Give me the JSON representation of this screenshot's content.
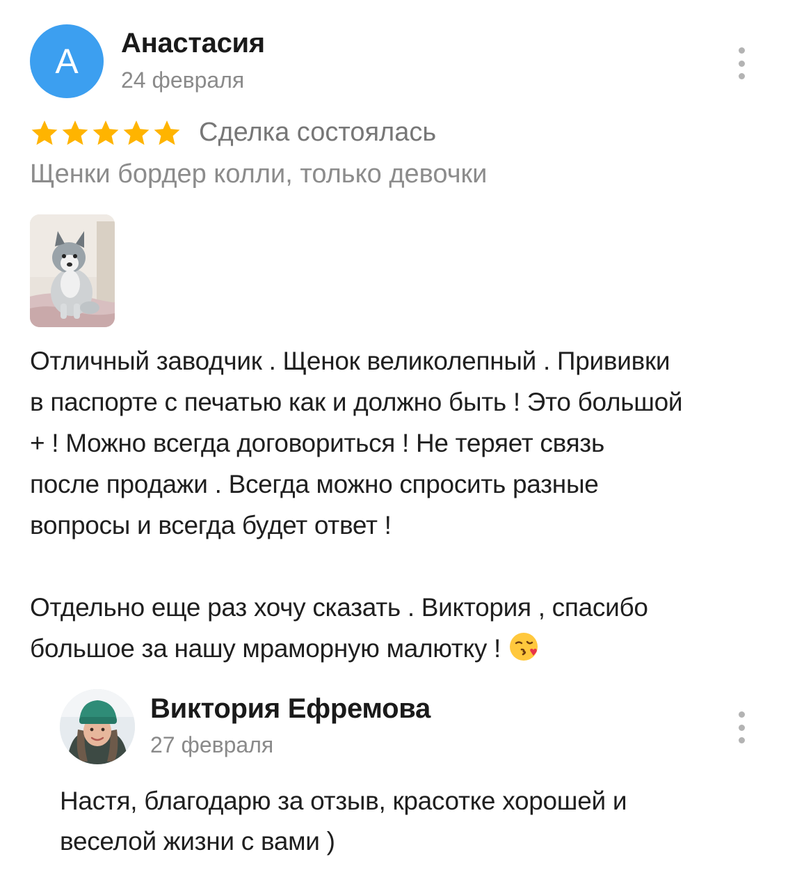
{
  "review": {
    "avatar_letter": "A",
    "author": "Анастасия",
    "date": "24 февраля",
    "rating": 5,
    "deal_status": "Сделка состоялась",
    "listing_title": "Щенки бордер колли, только девочки",
    "photo_icon": "puppy-photo",
    "text_line_1": "Отличный заводчик . Щенок великолепный . Прививки",
    "text_line_2": "в паспорте с печатью как и должно быть ! Это большой",
    "text_line_3": "+ ! Можно всегда договориться ! Не теряет связь",
    "text_line_4": "после продажи . Всегда можно спросить разные",
    "text_line_5": "вопросы и всегда будет ответ !",
    "text_line_6": "Отдельно еще раз хочу сказать . Виктория , спасибо",
    "text_line_7": "большое за нашу мраморную малютку !",
    "emoji_icon": "kissing-face-heart-emoji"
  },
  "reply": {
    "author": "Виктория Ефремова",
    "date": "27 февраля",
    "text_line_1": "Настя, благодарю за отзыв, красотке хорошей и",
    "text_line_2": "веселой жизни с вами )"
  },
  "colors": {
    "avatar_bg": "#3c9ff0",
    "star": "#ffb400",
    "muted_text": "#8a8a8a"
  }
}
